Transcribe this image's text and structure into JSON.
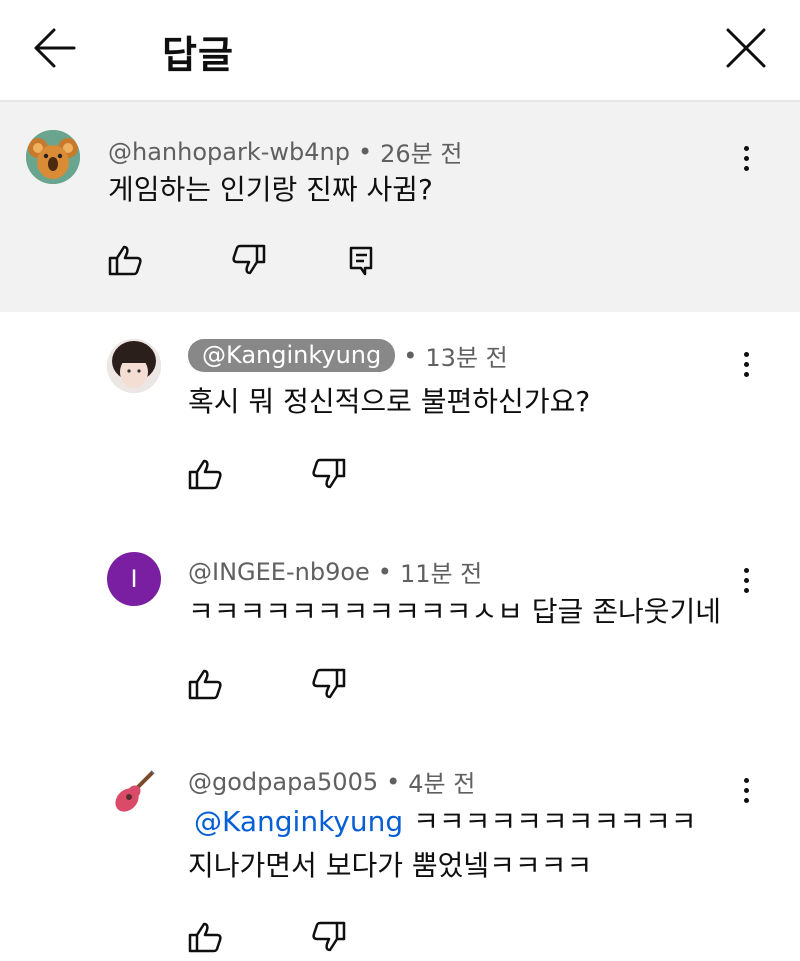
{
  "header": {
    "title": "답글",
    "back_icon": "arrow-left-icon",
    "close_icon": "close-icon"
  },
  "comments": [
    {
      "handle": "@hanhopark-wb4np",
      "separator": "•",
      "time": "26분 전",
      "lines": [
        "게임하는 인기랑 진짜 사귐?"
      ],
      "avatar_icon": "koala-avatar"
    },
    {
      "handle": "@Kanginkyung",
      "separator": "•",
      "time": "13분 전",
      "lines": [
        "혹시 뭐 정신적으로 불편하신가요?"
      ],
      "avatar_icon": "photo-avatar"
    },
    {
      "handle": "@INGEE-nb9oe",
      "separator": "•",
      "time": "11분 전",
      "lines": [
        "ㅋㅋㅋㅋㅋㅋㅋㅋㅋㅋㅋㅅㅂ 답글 존나웃기네"
      ],
      "avatar_letter": "I",
      "avatar_color": "#7b1fa2"
    },
    {
      "handle": "@godpapa5005",
      "separator": "•",
      "time": "4분 전",
      "mention": "@Kanginkyung",
      "lines": [
        "ㅋㅋㅋㅋㅋㅋㅋㅋㅋㅋㅋ",
        "지나가면서 보다가 뿜었넼ㅋㅋㅋㅋ"
      ],
      "avatar_icon": "guitar-avatar"
    }
  ]
}
